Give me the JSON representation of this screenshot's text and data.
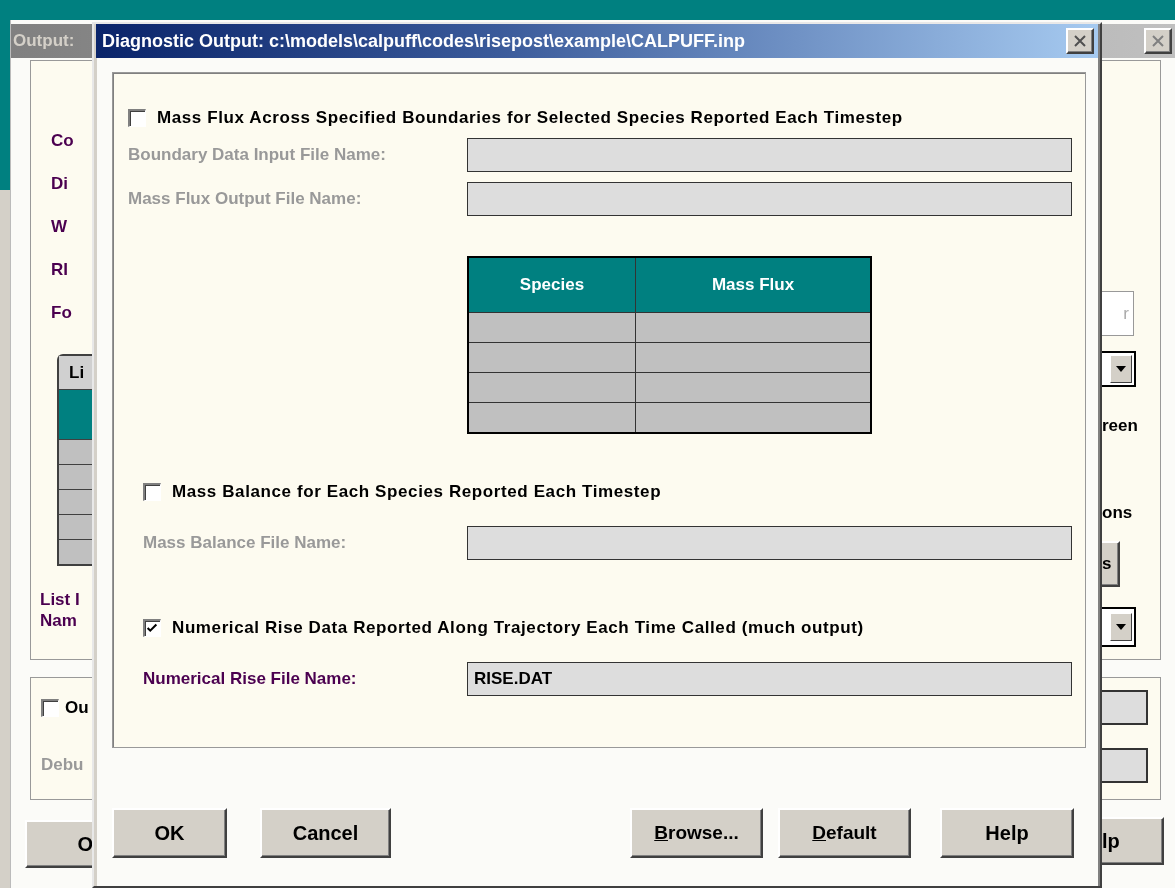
{
  "output_window": {
    "title": "Output:",
    "labels": [
      "Co",
      "Di",
      "W",
      "RI",
      "Fo"
    ],
    "list": {
      "header": "Li",
      "rows": [
        {
          "selected": true
        },
        {
          "selected": false
        },
        {
          "selected": false
        },
        {
          "selected": false
        },
        {
          "selected": false
        },
        {
          "selected": false
        }
      ]
    },
    "list_caption": [
      "List I",
      "Nam"
    ],
    "output_checkbox": {
      "label": "Ou",
      "checked": false
    },
    "debug_label": "Debu",
    "left_button": "O",
    "field_value": "r",
    "screen_label": "reen",
    "options_label": "ons",
    "options_button": "s",
    "help_button": "lp"
  },
  "dialog": {
    "title": "Diagnostic Output: c:\\models\\calpuff\\codes\\risepost\\example\\CALPUFF.inp",
    "sections": [
      {
        "label": "Mass Flux Across Specified Boundaries for Selected Species Reported Each Timestep",
        "checked": false,
        "fields": [
          {
            "label": "Boundary Data Input File Name:",
            "disabled": true
          },
          {
            "label": "Mass Flux Output File Name:",
            "disabled": true
          }
        ],
        "table": {
          "columns": [
            "Species",
            "Mass Flux"
          ]
        }
      },
      {
        "label": "Mass Balance for Each Species Reported Each Timestep",
        "checked": false,
        "fields": [
          {
            "label": "Mass Balance File Name:",
            "disabled": true
          }
        ]
      },
      {
        "label": "Numerical Rise Data Reported Along Trajectory Each Time Called (much output)",
        "checked": true,
        "fields": [
          {
            "label": "Numerical Rise File Name:",
            "disabled": false,
            "value": "RISE.DAT"
          }
        ]
      }
    ],
    "buttons": [
      {
        "label": "OK",
        "mnemonic": false
      },
      {
        "label": "Cancel",
        "mnemonic": false
      },
      {
        "label": "Browse...",
        "mnemonic": true
      },
      {
        "label": "Default",
        "mnemonic": true
      },
      {
        "label": "Help",
        "mnemonic": false
      }
    ]
  }
}
